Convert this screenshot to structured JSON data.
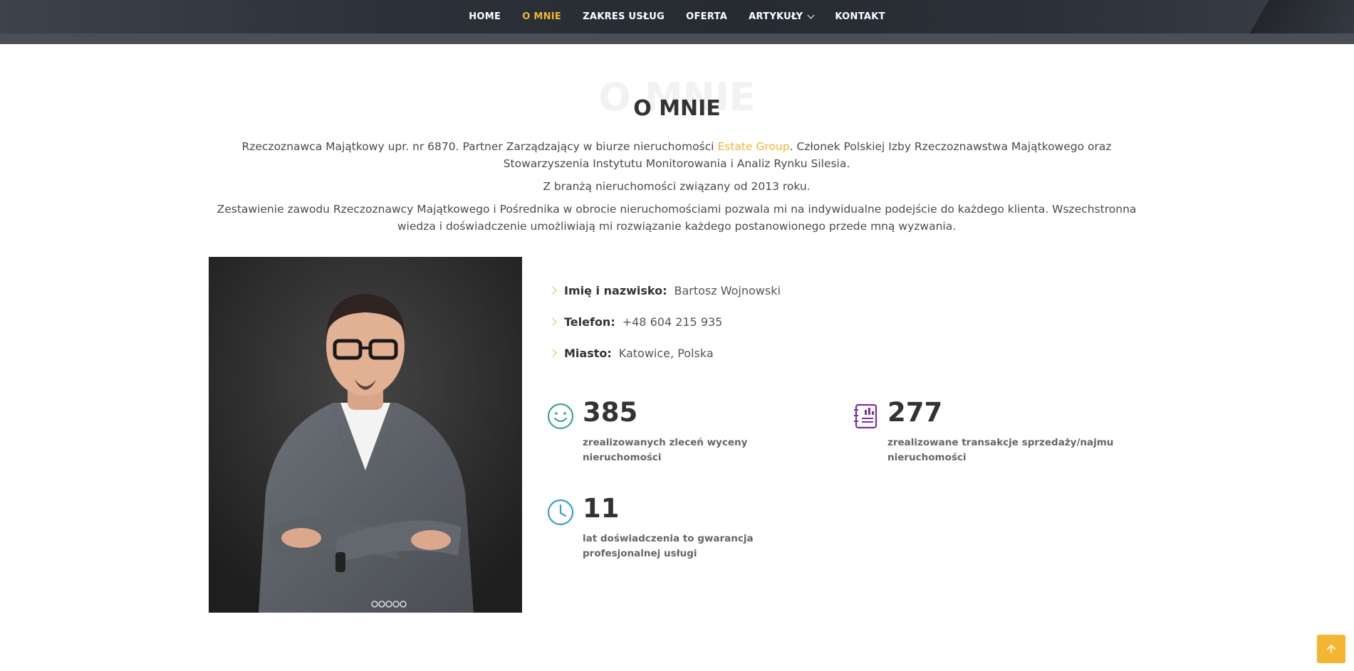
{
  "nav": {
    "items": [
      {
        "label": "HOME",
        "active": false,
        "dropdown": false
      },
      {
        "label": "O MNIE",
        "active": true,
        "dropdown": false
      },
      {
        "label": "ZAKRES USŁUG",
        "active": false,
        "dropdown": false
      },
      {
        "label": "OFERTA",
        "active": false,
        "dropdown": false
      },
      {
        "label": "ARTYKUŁY",
        "active": false,
        "dropdown": true
      },
      {
        "label": "KONTAKT",
        "active": false,
        "dropdown": false
      }
    ]
  },
  "section": {
    "bg_title": "O MNIE",
    "title": "O MNIE"
  },
  "intro": {
    "p1_before": "Rzeczoznawca Majątkowy upr. nr 6870. Partner Zarządzający w biurze nieruchomości ",
    "p1_link": "Estate Group",
    "p1_after": ". Członek Polskiej Izby Rzeczoznawstwa Majątkowego oraz Stowarzyszenia Instytutu Monitorowania i Analiz Rynku Silesia.",
    "p2": "Z branżą nieruchomości związany od 2013 roku.",
    "p3": "Zestawienie zawodu Rzeczoznawcy Majątkowego i Pośrednika w obrocie nieruchomościami pozwala mi na indywidualne podejście do każdego klienta. Wszechstronna wiedza i doświadczenie umożliwiają mi rozwiązanie każdego postanowionego przede mną wyzwania."
  },
  "info": [
    {
      "key": "Imię i nazwisko:",
      "value": "Bartosz Wojnowski"
    },
    {
      "key": "Telefon:",
      "value": "+48 604 215 935"
    },
    {
      "key": "Miasto:",
      "value": "Katowice, Polska"
    }
  ],
  "stats": [
    {
      "number": "385",
      "label": "zrealizowanych zleceń wyceny nieruchomości",
      "icon": "smile-icon",
      "color": "#3aa58b"
    },
    {
      "number": "277",
      "label": "zrealizowane transakcje sprzedaży/najmu nieruchomości",
      "icon": "report-icon",
      "color": "#7b2fa8"
    },
    {
      "number": "11",
      "label": "lat doświadczenia to gwarancja profesjonalnej usługi",
      "icon": "clock-icon",
      "color": "#3b9bd6"
    }
  ],
  "colors": {
    "accent": "#f2b632",
    "nav_bg": "#2c3038"
  }
}
